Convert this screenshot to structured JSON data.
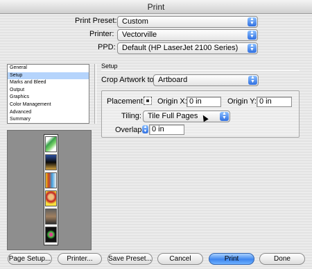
{
  "window": {
    "title": "Print"
  },
  "top": {
    "preset_label": "Print Preset:",
    "preset_value": "Custom",
    "printer_label": "Printer:",
    "printer_value": "Vectorville",
    "ppd_label": "PPD:",
    "ppd_value": "Default (HP LaserJet 2100 Series)"
  },
  "sidebar": {
    "items": [
      {
        "label": "General"
      },
      {
        "label": "Setup"
      },
      {
        "label": "Marks and Bleed"
      },
      {
        "label": "Output"
      },
      {
        "label": "Graphics"
      },
      {
        "label": "Color Management"
      },
      {
        "label": "Advanced"
      },
      {
        "label": "Summary"
      }
    ],
    "selected": "Setup"
  },
  "setup": {
    "title": "Setup",
    "crop_label": "Crop Artwork to:",
    "crop_value": "Artboard",
    "placement_label": "Placement:",
    "origin_x_label": "Origin X:",
    "origin_x_value": "0 in",
    "origin_y_label": "Origin Y:",
    "origin_y_value": "0 in",
    "tiling_label": "Tiling:",
    "tiling_value": "Tile Full Pages",
    "overlap_label": "Overlap:",
    "overlap_value": "0 in"
  },
  "buttons": {
    "page_setup": "Page Setup...",
    "printer": "Printer...",
    "save_preset": "Save Preset...",
    "cancel": "Cancel",
    "print": "Print",
    "done": "Done"
  },
  "colors": {
    "accent": "#3f87ef",
    "selection": "#b5d4fc",
    "preview_bg": "#8e8e8e"
  }
}
